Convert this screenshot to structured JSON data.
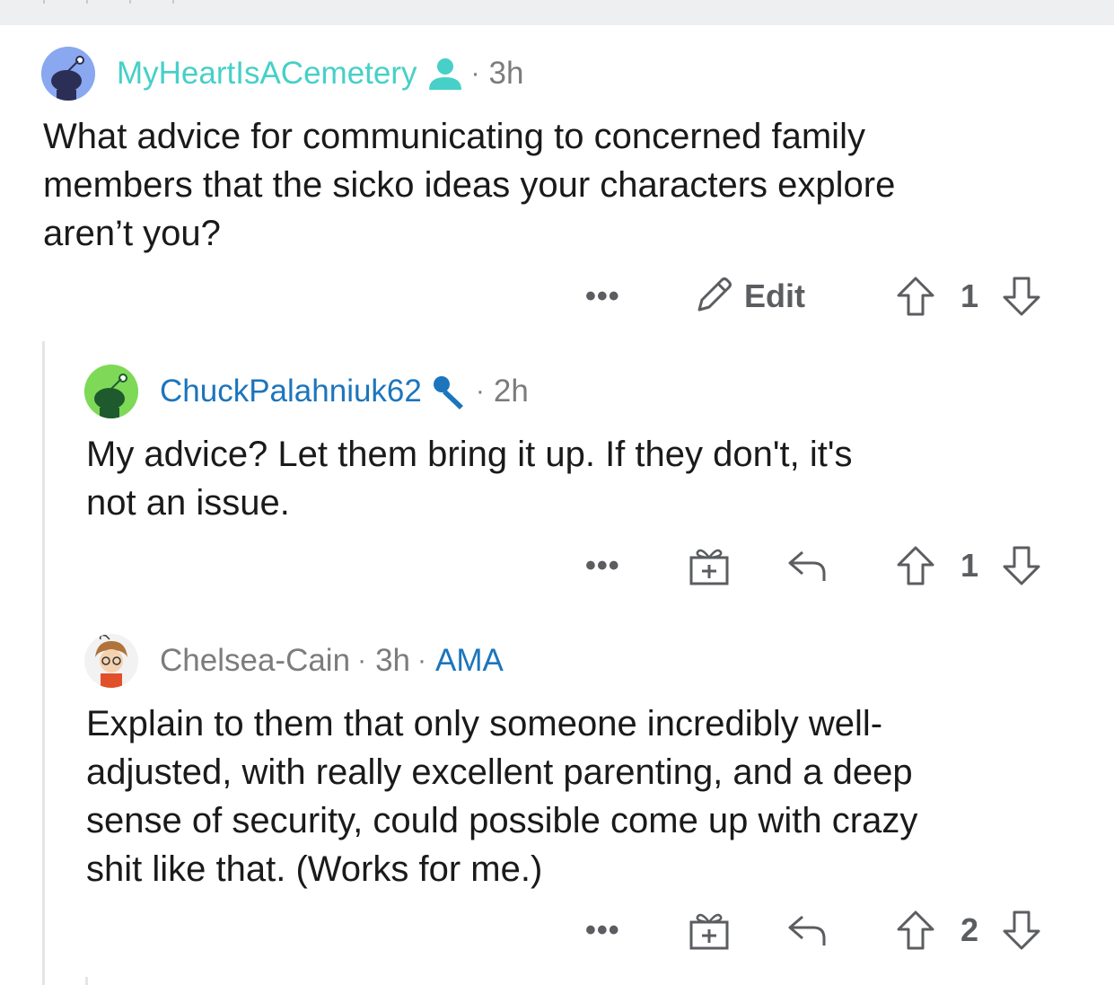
{
  "colors": {
    "op_username": "#46d0c7",
    "link_blue": "#1c75bc",
    "meta_grey": "#7c7c7c",
    "icon_grey": "#5b5d60",
    "thread_line": "#e3e5e8"
  },
  "comments": [
    {
      "username": "MyHeartIsACemetery",
      "flair_icon": "user-silhouette-icon",
      "separator": "·",
      "time": "3h",
      "body": "What advice for communicating to concerned family\nmembers that the sicko ideas your characters explore\naren’t you?",
      "more_label": "•••",
      "edit_label": "Edit",
      "score": "1"
    },
    {
      "username": "ChuckPalahniuk62",
      "flair_icon": "microphone-icon",
      "separator": "·",
      "time": "2h",
      "body": "My advice?  Let them bring it up.  If they don't, it's\nnot an issue.",
      "more_label": "•••",
      "score": "1"
    },
    {
      "username": "Chelsea-Cain",
      "separator": "·",
      "time": "3h",
      "separator2": "·",
      "tag": "AMA",
      "body": "Explain to them that only someone incredibly well-\nadjusted, with really excellent parenting, and a deep\nsense of security, could possible come up with crazy\nshit like that. (Works for me.)",
      "more_label": "•••",
      "score": "2"
    }
  ]
}
